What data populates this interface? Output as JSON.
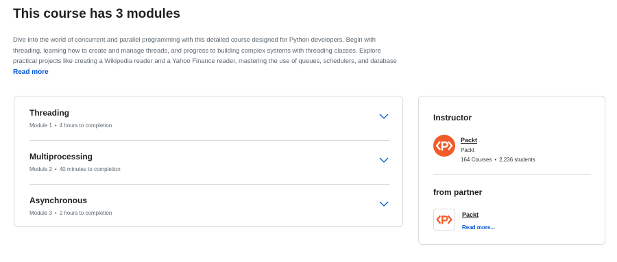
{
  "header": {
    "title": "This course has 3 modules",
    "description_lines": [
      "Dive into the world of concurrent and parallel programming with this detailed course designed for Python developers. Begin with",
      "threading, learning how to create and manage threads, and progress to building complex systems with threading classes. Explore",
      "practical projects like creating a Wikipedia reader and a Yahoo Finance reader, mastering the use of queues, schedulers, and database"
    ],
    "read_more": "Read more"
  },
  "modules": [
    {
      "name": "Threading",
      "number": "Module 1",
      "duration": "4 hours to completion"
    },
    {
      "name": "Multiprocessing",
      "number": "Module 2",
      "duration": "40 minutes to completion"
    },
    {
      "name": "Asynchronous",
      "number": "Module 3",
      "duration": "2 hours to completion"
    }
  ],
  "meta_separator": "•",
  "instructor": {
    "heading": "Instructor",
    "name": "Packt",
    "org": "Packt",
    "courses": "164 Courses",
    "students": "2,236 students",
    "logo_color": "#f15a29",
    "logo_icon": "packt-logo-icon"
  },
  "partner": {
    "heading": "from partner",
    "name": "Packt",
    "link": "Read more...",
    "logo_color": "#f15a29",
    "logo_icon": "packt-logo-icon"
  },
  "colors": {
    "link": "#0056d2",
    "border": "#dadada",
    "muted_text": "#5b6770",
    "brand_orange": "#f15a29"
  }
}
